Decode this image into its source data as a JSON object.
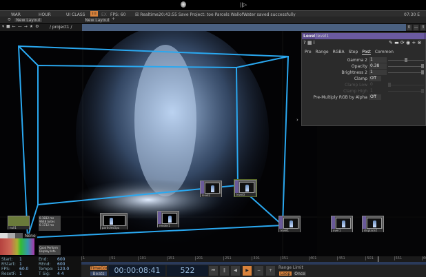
{
  "topbar": {
    "play_icon": "play-pause-icon",
    "logo_icon": "touchdesigner-logo-icon"
  },
  "menubar": {
    "items": [
      "WAR",
      "HOUR",
      "UI CLASS"
    ],
    "warning": "!!!",
    "ex": "EX",
    "fps": "FPS: 60",
    "realtime": "Realtime",
    "message": "20:43:55 Save Project: toe  Parcels WallofWater saved successfully",
    "time": "07:30 E"
  },
  "layout_tabs": [
    "New Layout",
    "New Layout"
  ],
  "pathbar": {
    "path": "/ project1 /",
    "right_buttons": [
      "0",
      "—",
      "3"
    ]
  },
  "colors": {
    "accent": "#d9823b",
    "box": "#2aa8f0",
    "panel_header": "#5a4a8a",
    "timeline_bg": "#1e2a3c"
  },
  "param_panel": {
    "type": "Level",
    "name": "level1",
    "tabs": [
      "Pre",
      "Range",
      "RGBA",
      "Step",
      "Post",
      "Common"
    ],
    "active_tab": "Post",
    "params": [
      {
        "label": "Gamma 2",
        "value": "1",
        "slider": 0.5,
        "enabled": true
      },
      {
        "label": "Opacity",
        "value": "0.38",
        "slider": 1.0,
        "enabled": true
      },
      {
        "label": "Brightness 2",
        "value": "1",
        "slider": 1.0,
        "enabled": true
      },
      {
        "label": "Clamp",
        "value": "Off",
        "enabled": true
      },
      {
        "label": "Clamp Low",
        "value": "0",
        "slider": 0.0,
        "enabled": false
      },
      {
        "label": "Clamp High",
        "value": "1",
        "slider": 1.0,
        "enabled": false
      },
      {
        "label": "Pre-Multiply RGB by Alpha",
        "value": "Off",
        "enabled": true
      }
    ]
  },
  "nodes": [
    {
      "label": "null1"
    },
    {
      "label": "level2"
    },
    {
      "label": "level3"
    },
    {
      "label": "level1"
    },
    {
      "label": "over1"
    },
    {
      "label": "displace2"
    },
    {
      "label": "out1"
    },
    {
      "label": "particlesGpu"
    },
    {
      "label": "render1"
    }
  ],
  "side_labels": {
    "none": "None",
    "stats": [
      "0.1832 ms",
      "9648 bytes",
      "0.1732 ms"
    ],
    "stats2": [
      "Cook Perform",
      "Display Info"
    ]
  },
  "timeline": {
    "info": [
      [
        "Start:",
        "1",
        "End:",
        "600"
      ],
      [
        "RStart:",
        "1",
        "REnd:",
        "600"
      ],
      [
        "FPS:",
        "60.0",
        "Tempo:",
        "120.0"
      ],
      [
        "ResetF:",
        "1",
        "T Sig:",
        "4  4"
      ]
    ],
    "ticks": [
      1,
      51,
      101,
      151,
      201,
      251,
      301,
      351,
      401,
      451,
      501,
      551,
      600
    ],
    "range": [
      1,
      600
    ],
    "current_frame": 522,
    "timecode_label": "TimeCode",
    "beats_label": "Beats",
    "timecode": "00:00:08:41",
    "frame": "522",
    "transport": [
      "⏮",
      "‖",
      "◀",
      "▶",
      "−",
      "+"
    ],
    "range_limit": "Range Limit",
    "loop": "Loop",
    "once": "Once"
  }
}
